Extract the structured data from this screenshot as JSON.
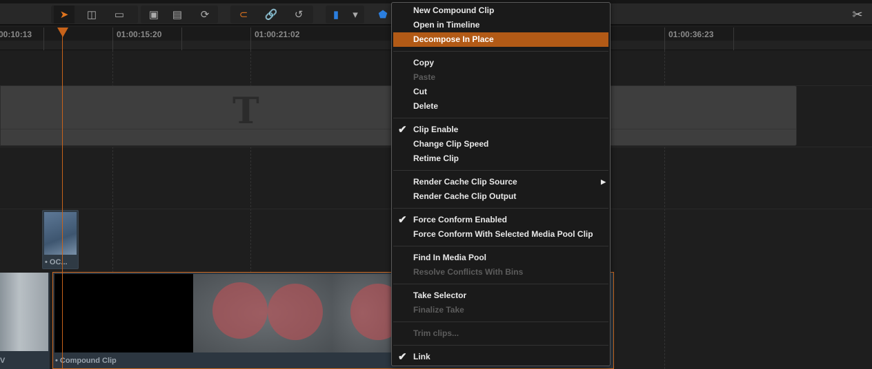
{
  "toolbar": {
    "buttons": [
      {
        "name": "selection-arrow-icon",
        "glyph": "➤",
        "active": true
      },
      {
        "name": "trim-edit-icon",
        "glyph": "◫"
      },
      {
        "name": "razor-blade-icon",
        "glyph": "▭"
      },
      {
        "name": "insert-clip-icon",
        "glyph": "▣"
      },
      {
        "name": "overwrite-clip-icon",
        "glyph": "▤"
      },
      {
        "name": "replace-clip-icon",
        "glyph": "⟳"
      },
      {
        "name": "snapping-magnet-icon",
        "glyph": "⊂",
        "active": true
      },
      {
        "name": "linked-selection-icon",
        "glyph": "🔗",
        "active": true
      },
      {
        "name": "loop-icon",
        "glyph": "↺"
      },
      {
        "name": "flag-icon",
        "glyph": "▮"
      },
      {
        "name": "flag-dropdown-icon",
        "glyph": "▾"
      },
      {
        "name": "marker-icon",
        "glyph": "⬟"
      }
    ],
    "settings_icon": "tools-icon"
  },
  "ruler": {
    "timecodes": [
      "00:10:13",
      "01:00:15:20",
      "01:00:21:02",
      "01:00:36:23"
    ]
  },
  "clips": {
    "small_clip_label": "• OC...",
    "left_clip_label": "V",
    "compound_clip_label": "• Compound Clip",
    "title_glyph": "T"
  },
  "colors": {
    "accent": "#c8631a",
    "highlight": "#b25a16"
  },
  "context_menu": {
    "items": [
      {
        "label": "New Compound Clip"
      },
      {
        "label": "Open in Timeline"
      },
      {
        "label": "Decompose In Place",
        "highlighted": true
      },
      {
        "sep": true
      },
      {
        "label": "Copy"
      },
      {
        "label": "Paste",
        "disabled": true
      },
      {
        "label": "Cut"
      },
      {
        "label": "Delete"
      },
      {
        "sep": true
      },
      {
        "label": "Clip Enable",
        "checked": true
      },
      {
        "label": "Change Clip Speed"
      },
      {
        "label": "Retime Clip"
      },
      {
        "sep": true
      },
      {
        "label": "Render Cache Clip Source",
        "submenu": true
      },
      {
        "label": "Render Cache Clip Output"
      },
      {
        "sep": true
      },
      {
        "label": "Force Conform Enabled",
        "checked": true
      },
      {
        "label": "Force Conform With Selected Media Pool Clip"
      },
      {
        "sep": true
      },
      {
        "label": "Find In Media Pool"
      },
      {
        "label": "Resolve Conflicts With Bins",
        "disabled": true
      },
      {
        "sep": true
      },
      {
        "label": "Take Selector"
      },
      {
        "label": "Finalize Take",
        "disabled": true
      },
      {
        "sep": true
      },
      {
        "label": "Trim clips...",
        "disabled": true
      },
      {
        "sep": true
      },
      {
        "label": "Link",
        "checked": true
      }
    ]
  }
}
